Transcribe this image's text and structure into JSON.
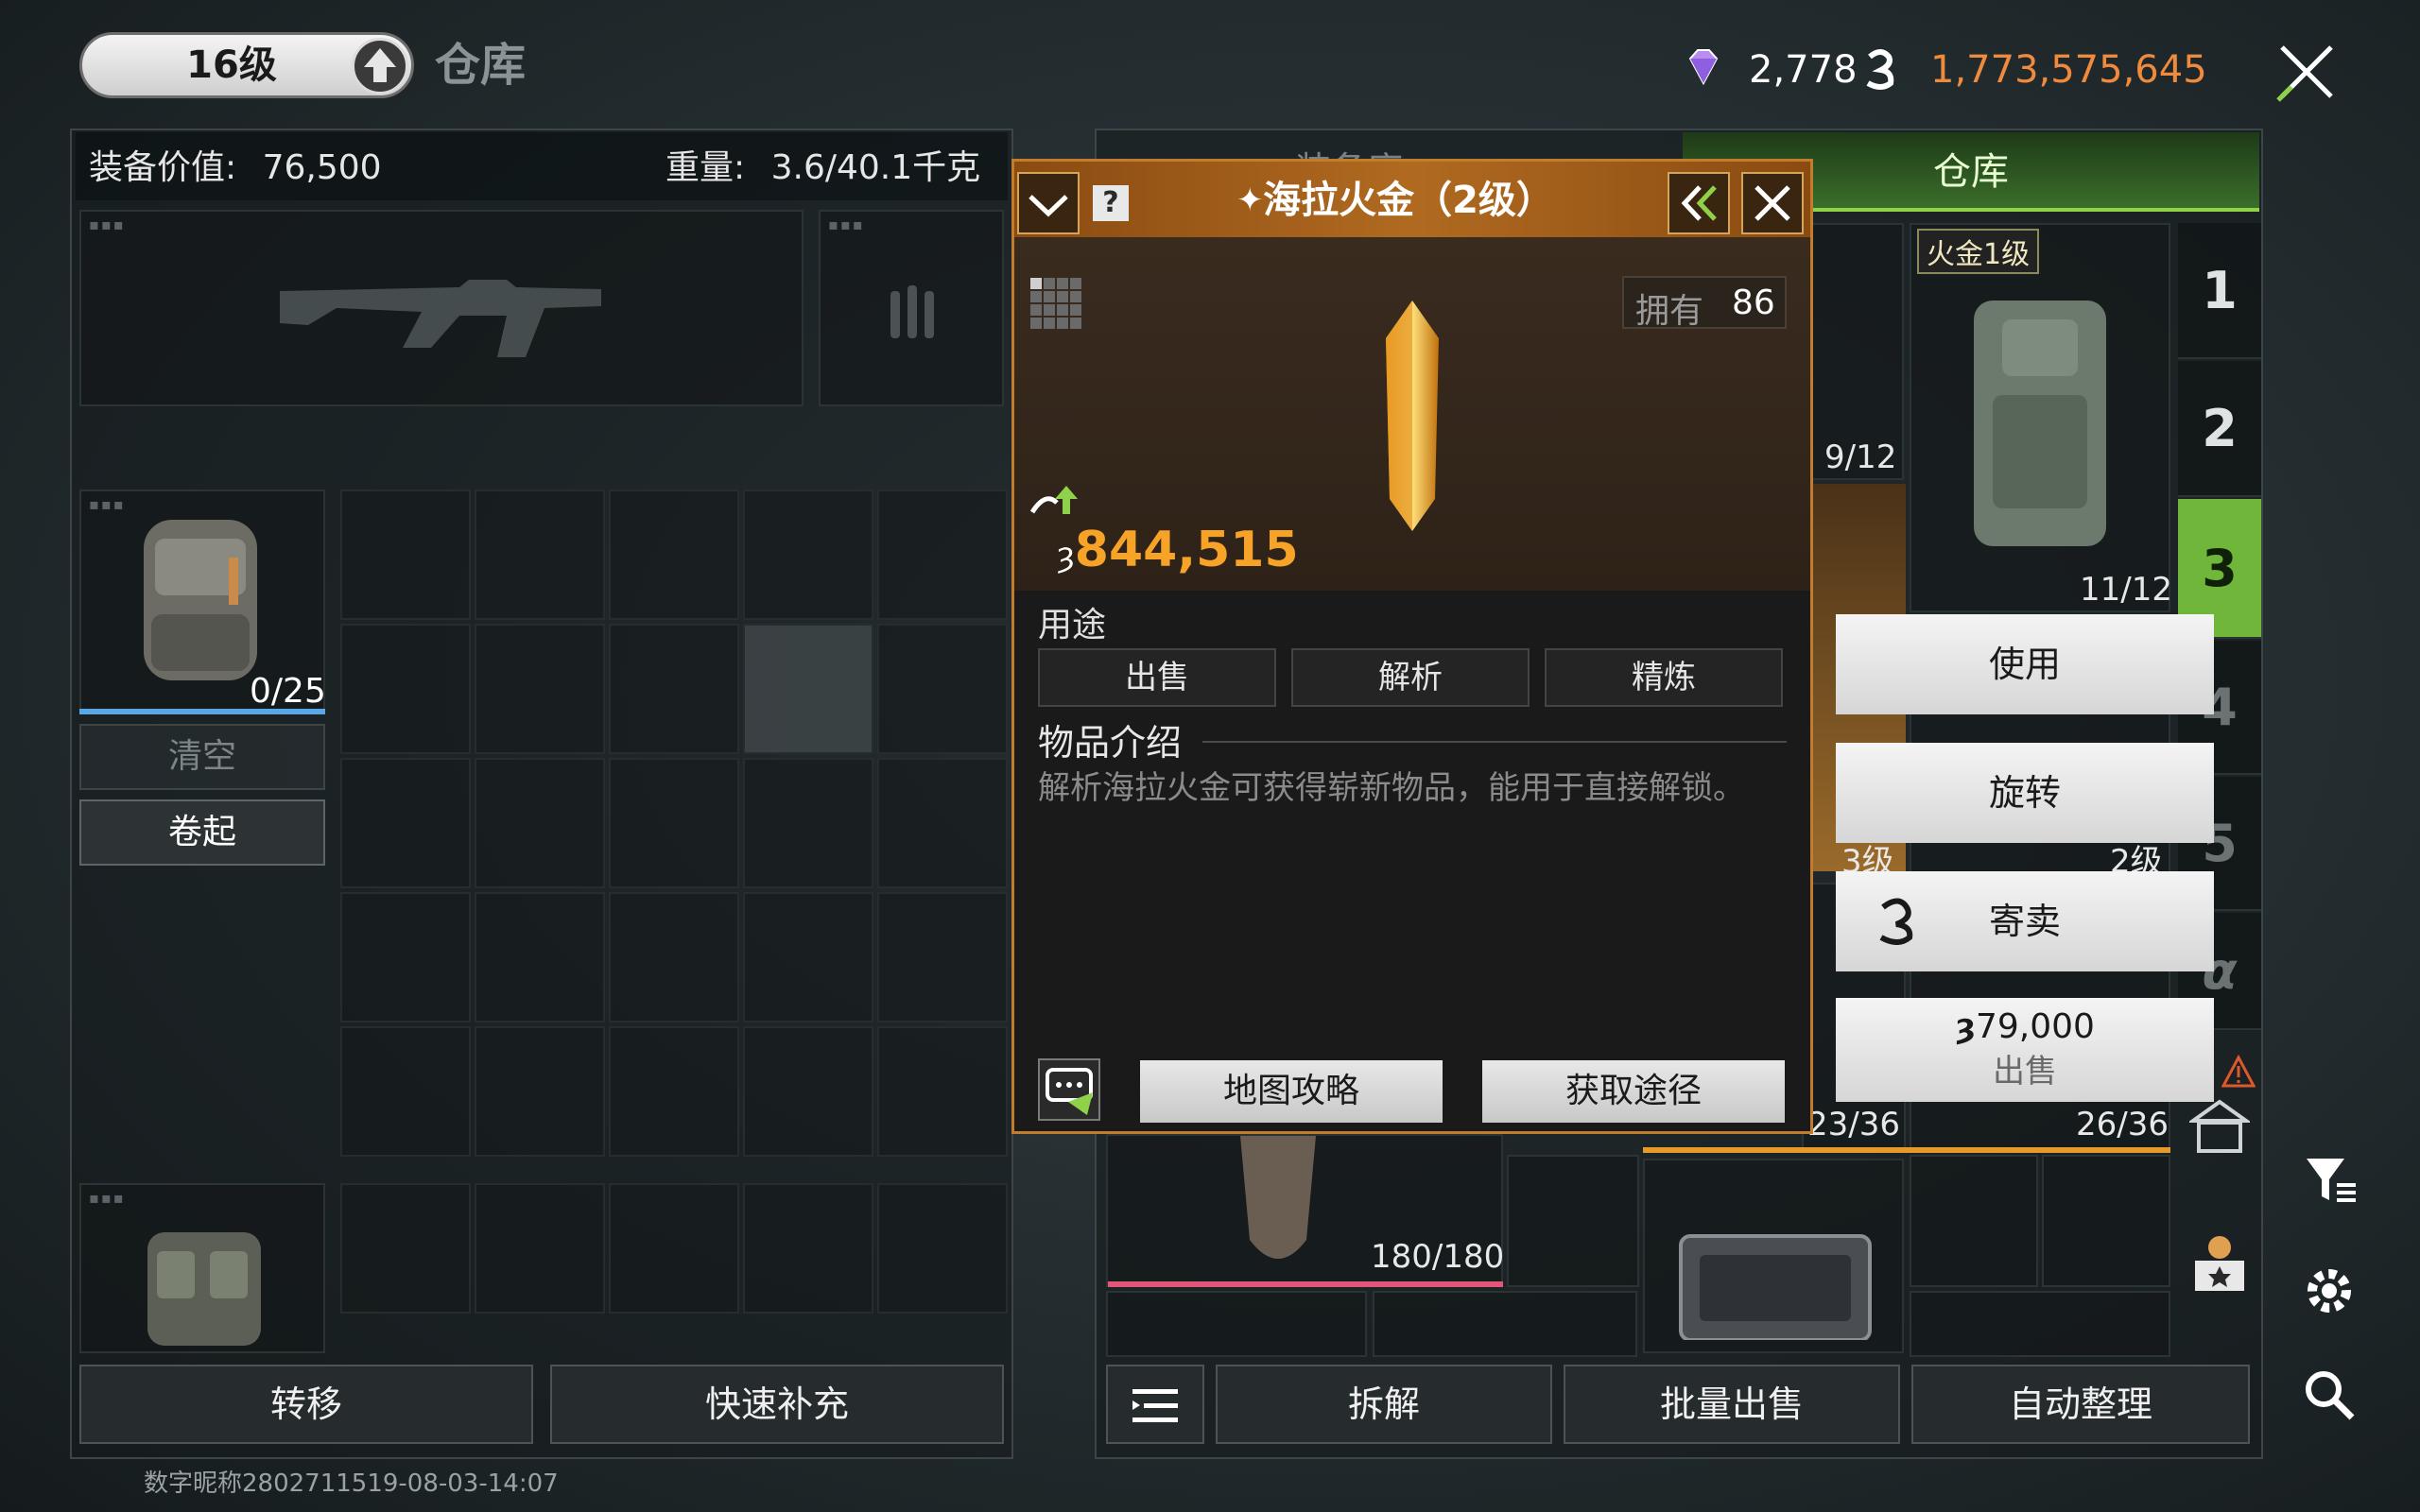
{
  "header": {
    "level": "16级",
    "title": "仓库",
    "gems": "2,778",
    "coins": "1,773,575,645"
  },
  "left": {
    "equip_value_label": "装备价值:",
    "equip_value": "76,500",
    "weight_label": "重量:",
    "weight_value": "3.6/40.1千克",
    "backpack_capacity": "0/25",
    "clear_button": "清空",
    "rollup_button": "卷起",
    "transfer_button": "转移",
    "quick_refill_button": "快速补充"
  },
  "right": {
    "tab_gear": "装备库",
    "tab_warehouse": "仓库",
    "side_tabs": [
      "1",
      "2",
      "3",
      "4",
      "5",
      "α"
    ],
    "active_tab": "3",
    "vest_badge": "火金1级",
    "counter_a": "9/12",
    "counter_b": "11/12",
    "counter_c": "23/36",
    "counter_d": "26/36",
    "counter_e": "180/180",
    "level_c": "3级",
    "level_d": "2级",
    "dismantle_button": "拆解",
    "bulk_sell_button": "批量出售",
    "auto_sort_button": "自动整理"
  },
  "context_menu": {
    "use": "使用",
    "rotate": "旋转",
    "consign": "寄卖",
    "sell_price": "79,000",
    "sell": "出售"
  },
  "popup": {
    "title": "海拉火金（2级）",
    "own_label": "拥有",
    "own_count": "86",
    "price": "844,515",
    "usage_label": "用途",
    "usage_buttons": [
      "出售",
      "解析",
      "精炼"
    ],
    "desc_label": "物品介绍",
    "desc_text": "解析海拉火金可获得崭新物品，能用于直接解锁。",
    "map_guide_button": "地图攻略",
    "obtain_button": "获取途径"
  },
  "footer": {
    "user_stamp": "数字昵称2802711519-08-03-14:07"
  },
  "colors": {
    "accent_green": "#8fd24a",
    "coin_orange": "#f08a3c",
    "popup_border": "#c27d2c",
    "price_gold": "#f6a328"
  }
}
